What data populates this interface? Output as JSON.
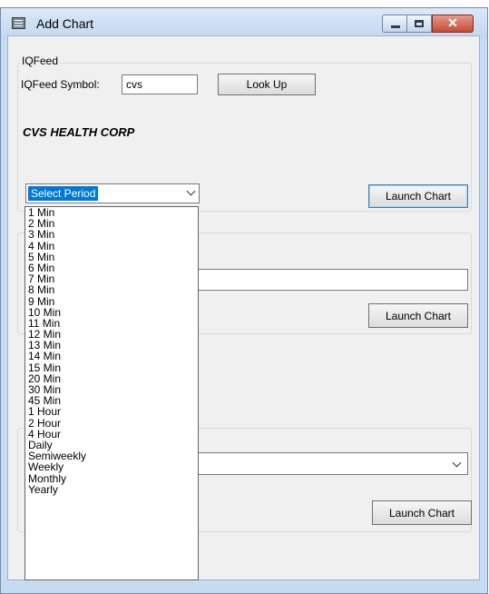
{
  "window": {
    "title": "Add Chart"
  },
  "iqfeed": {
    "group_label": "IQFeed",
    "symbol_label": "IQFeed Symbol:",
    "symbol_value": "cvs",
    "lookup_label": "Look Up",
    "company_name": "CVS HEALTH CORP",
    "period_selected": "Select Period",
    "launch_label": "Launch Chart"
  },
  "group2": {
    "launch_label": "Launch Chart",
    "input_value": ""
  },
  "group3": {
    "launch_label": "Launch Chart"
  },
  "period_options": [
    "1 Min",
    "2 Min",
    "3 Min",
    "4 Min",
    "5 Min",
    "6 Min",
    "7 Min",
    "8 Min",
    "9 Min",
    "10 Min",
    "11 Min",
    "12 Min",
    "13 Min",
    "14 Min",
    "15 Min",
    "20 Min",
    "30 Min",
    "45 Min",
    "1 Hour",
    "2 Hour",
    "4 Hour",
    "Daily",
    "Semiweekly",
    "Weekly",
    "Monthly",
    "Yearly"
  ]
}
